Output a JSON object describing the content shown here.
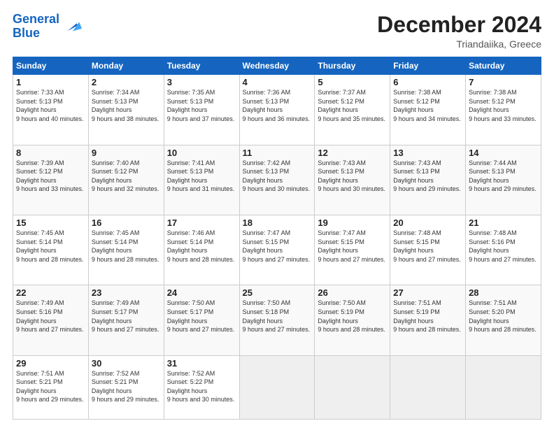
{
  "header": {
    "logo_line1": "General",
    "logo_line2": "Blue",
    "month_year": "December 2024",
    "location": "Triandaiika, Greece"
  },
  "weekdays": [
    "Sunday",
    "Monday",
    "Tuesday",
    "Wednesday",
    "Thursday",
    "Friday",
    "Saturday"
  ],
  "weeks": [
    [
      {
        "day": 1,
        "rise": "7:33 AM",
        "set": "5:13 PM",
        "hours": "9 hours and 40 minutes."
      },
      {
        "day": 2,
        "rise": "7:34 AM",
        "set": "5:13 PM",
        "hours": "9 hours and 38 minutes."
      },
      {
        "day": 3,
        "rise": "7:35 AM",
        "set": "5:13 PM",
        "hours": "9 hours and 37 minutes."
      },
      {
        "day": 4,
        "rise": "7:36 AM",
        "set": "5:13 PM",
        "hours": "9 hours and 36 minutes."
      },
      {
        "day": 5,
        "rise": "7:37 AM",
        "set": "5:12 PM",
        "hours": "9 hours and 35 minutes."
      },
      {
        "day": 6,
        "rise": "7:38 AM",
        "set": "5:12 PM",
        "hours": "9 hours and 34 minutes."
      },
      {
        "day": 7,
        "rise": "7:38 AM",
        "set": "5:12 PM",
        "hours": "9 hours and 33 minutes."
      }
    ],
    [
      {
        "day": 8,
        "rise": "7:39 AM",
        "set": "5:12 PM",
        "hours": "9 hours and 33 minutes."
      },
      {
        "day": 9,
        "rise": "7:40 AM",
        "set": "5:12 PM",
        "hours": "9 hours and 32 minutes."
      },
      {
        "day": 10,
        "rise": "7:41 AM",
        "set": "5:13 PM",
        "hours": "9 hours and 31 minutes."
      },
      {
        "day": 11,
        "rise": "7:42 AM",
        "set": "5:13 PM",
        "hours": "9 hours and 30 minutes."
      },
      {
        "day": 12,
        "rise": "7:43 AM",
        "set": "5:13 PM",
        "hours": "9 hours and 30 minutes."
      },
      {
        "day": 13,
        "rise": "7:43 AM",
        "set": "5:13 PM",
        "hours": "9 hours and 29 minutes."
      },
      {
        "day": 14,
        "rise": "7:44 AM",
        "set": "5:13 PM",
        "hours": "9 hours and 29 minutes."
      }
    ],
    [
      {
        "day": 15,
        "rise": "7:45 AM",
        "set": "5:14 PM",
        "hours": "9 hours and 28 minutes."
      },
      {
        "day": 16,
        "rise": "7:45 AM",
        "set": "5:14 PM",
        "hours": "9 hours and 28 minutes."
      },
      {
        "day": 17,
        "rise": "7:46 AM",
        "set": "5:14 PM",
        "hours": "9 hours and 28 minutes."
      },
      {
        "day": 18,
        "rise": "7:47 AM",
        "set": "5:15 PM",
        "hours": "9 hours and 27 minutes."
      },
      {
        "day": 19,
        "rise": "7:47 AM",
        "set": "5:15 PM",
        "hours": "9 hours and 27 minutes."
      },
      {
        "day": 20,
        "rise": "7:48 AM",
        "set": "5:15 PM",
        "hours": "9 hours and 27 minutes."
      },
      {
        "day": 21,
        "rise": "7:48 AM",
        "set": "5:16 PM",
        "hours": "9 hours and 27 minutes."
      }
    ],
    [
      {
        "day": 22,
        "rise": "7:49 AM",
        "set": "5:16 PM",
        "hours": "9 hours and 27 minutes."
      },
      {
        "day": 23,
        "rise": "7:49 AM",
        "set": "5:17 PM",
        "hours": "9 hours and 27 minutes."
      },
      {
        "day": 24,
        "rise": "7:50 AM",
        "set": "5:17 PM",
        "hours": "9 hours and 27 minutes."
      },
      {
        "day": 25,
        "rise": "7:50 AM",
        "set": "5:18 PM",
        "hours": "9 hours and 27 minutes."
      },
      {
        "day": 26,
        "rise": "7:50 AM",
        "set": "5:19 PM",
        "hours": "9 hours and 28 minutes."
      },
      {
        "day": 27,
        "rise": "7:51 AM",
        "set": "5:19 PM",
        "hours": "9 hours and 28 minutes."
      },
      {
        "day": 28,
        "rise": "7:51 AM",
        "set": "5:20 PM",
        "hours": "9 hours and 28 minutes."
      }
    ],
    [
      {
        "day": 29,
        "rise": "7:51 AM",
        "set": "5:21 PM",
        "hours": "9 hours and 29 minutes."
      },
      {
        "day": 30,
        "rise": "7:52 AM",
        "set": "5:21 PM",
        "hours": "9 hours and 29 minutes."
      },
      {
        "day": 31,
        "rise": "7:52 AM",
        "set": "5:22 PM",
        "hours": "9 hours and 30 minutes."
      },
      null,
      null,
      null,
      null
    ]
  ]
}
